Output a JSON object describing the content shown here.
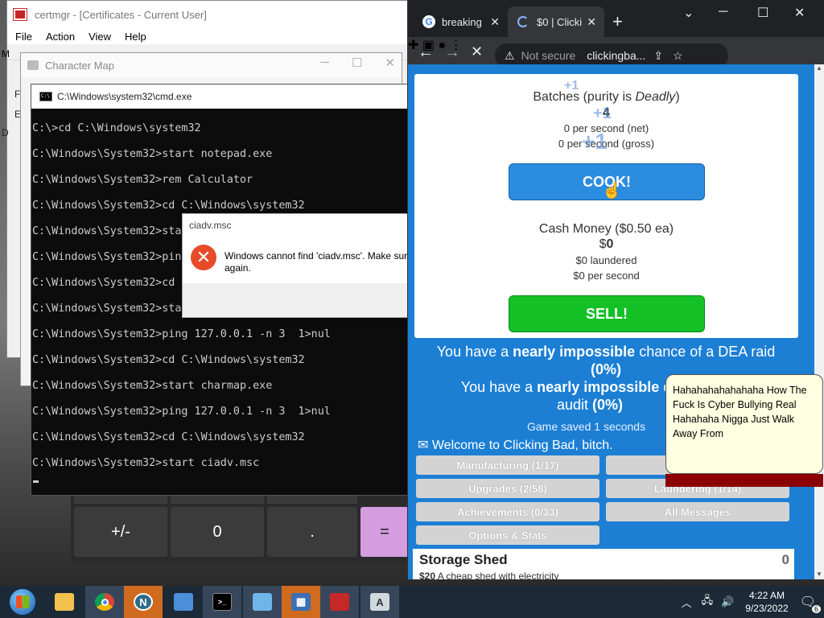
{
  "certmgr": {
    "title": "certmgr - [Certificates - Current User]",
    "menu": [
      "File",
      "Action",
      "View",
      "Help"
    ],
    "side_glyphs": [
      "M",
      "F",
      "E",
      "D",
      "c",
      "U"
    ]
  },
  "charmap": {
    "title": "Character Map",
    "minimize": "─",
    "maximize": "☐",
    "close": "✕"
  },
  "cmd": {
    "title": "C:\\Windows\\system32\\cmd.exe",
    "lines": [
      "C:\\>cd C:\\Windows\\system32",
      "C:\\Windows\\System32>start notepad.exe",
      "C:\\Windows\\System32>rem Calculator",
      "C:\\Windows\\System32>cd C:\\Windows\\system32",
      "C:\\Windows\\System32>start",
      "C:\\Windows\\System32>ping",
      "C:\\Windows\\System32>cd C",
      "C:\\Windows\\System32>star",
      "C:\\Windows\\System32>ping 127.0.0.1 -n 3  1>nul",
      "C:\\Windows\\System32>cd C:\\Windows\\system32",
      "C:\\Windows\\System32>start charmap.exe",
      "C:\\Windows\\System32>ping 127.0.0.1 -n 3  1>nul",
      "C:\\Windows\\System32>cd C:\\Windows\\system32",
      "C:\\Windows\\System32>start ciadv.msc"
    ]
  },
  "calculator": {
    "keys": [
      "+/-",
      "0",
      ".",
      "="
    ]
  },
  "error_dialog": {
    "title": "ciadv.msc",
    "message": "Windows cannot find 'ciadv.msc'. Make sur\nagain.",
    "icon": "error-icon"
  },
  "chrome": {
    "tabs": [
      {
        "label": "breaking",
        "icon": "google-icon"
      },
      {
        "label": "$0 | Clicki",
        "icon": "loading-icon"
      }
    ],
    "new_tab": "+",
    "address": {
      "security": "Not secure",
      "url": "clickingba..."
    }
  },
  "game": {
    "batches_prefix": "Batches (purity is ",
    "purity": "Deadly",
    "batches_suffix": ")",
    "batches_count": "4",
    "net_rate": "0 per second (net)",
    "gross_rate": "0 per second (gross)",
    "cook_label": "COOK!",
    "cash_title": "Cash Money ($0.50 ea)",
    "cash_symbol": "$",
    "cash_amount": "0",
    "laundered": "$0 laundered",
    "cash_rate": "$0 per second",
    "sell_label": "SELL!",
    "plus_one": "+1",
    "dea_prefix": "You have a ",
    "dea_bold": "nearly impossible",
    "dea_suffix": " chance of a DEA raid",
    "dea_pct": "(0%)",
    "audit_prefix": "You have a ",
    "audit_bold": "nearly impossible",
    "audit_suffix": " c",
    "audit_tail": "audit ",
    "audit_pct": "(0%)",
    "saved": "Game saved 1 seconds",
    "welcome": "Welcome to Clicking Bad, bitch.",
    "tabs": [
      {
        "label": "Manufacturing (1/17)"
      },
      {
        "label": "Dis"
      },
      {
        "label": "Upgrades (2/58)"
      },
      {
        "label": "Laundering (1/14)"
      },
      {
        "label": "Achievements (0/33)"
      },
      {
        "label": "All Messages"
      },
      {
        "label": "Options & Stats"
      }
    ],
    "shed": {
      "name": "Storage Shed",
      "count": "0",
      "price": "$20",
      "desc": "A cheap shed with electricity"
    }
  },
  "note": {
    "text": "Hahahahahahahaha How The Fuck Is Cyber Bullying Real Hahahaha Nigga Just Walk Away From"
  },
  "taskbar": {
    "time": "4:22 AM",
    "date": "9/23/2022",
    "notification_count": "6"
  }
}
